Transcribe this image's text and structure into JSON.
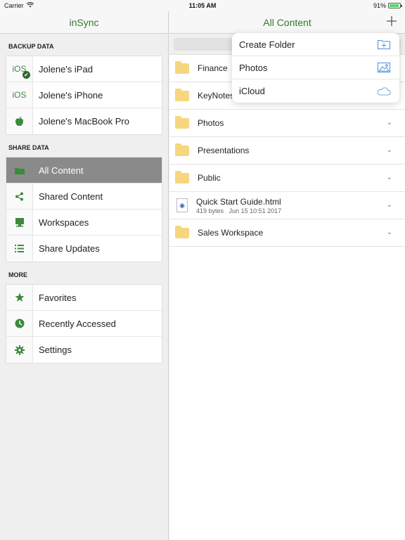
{
  "status": {
    "carrier": "Carrier",
    "time": "11:05 AM",
    "battery": "91%",
    "battery_level": 0.91
  },
  "sidebar": {
    "title": "inSync",
    "backup": {
      "header": "BACKUP DATA",
      "items": [
        {
          "label": "Jolene's iPad",
          "icon": "ios-icon",
          "icon_text": "iOS"
        },
        {
          "label": "Jolene's iPhone",
          "icon": "ios-icon",
          "icon_text": "iOS"
        },
        {
          "label": "Jolene's MacBook Pro",
          "icon": "apple-icon"
        }
      ]
    },
    "share": {
      "header": "SHARE DATA",
      "items": [
        {
          "label": "All Content",
          "icon": "folder-icon"
        },
        {
          "label": "Shared Content",
          "icon": "share-icon"
        },
        {
          "label": "Workspaces",
          "icon": "workspace-icon"
        },
        {
          "label": "Share Updates",
          "icon": "list-icon"
        }
      ]
    },
    "more": {
      "header": "MORE",
      "items": [
        {
          "label": "Favorites",
          "icon": "star-icon"
        },
        {
          "label": "Recently Accessed",
          "icon": "clock-icon"
        },
        {
          "label": "Settings",
          "icon": "gear-icon"
        }
      ]
    }
  },
  "main": {
    "title": "All Content",
    "files": [
      {
        "name": "Finance",
        "type": "folder"
      },
      {
        "name": "KeyNotes",
        "type": "folder"
      },
      {
        "name": "Photos",
        "type": "folder"
      },
      {
        "name": "Presentations",
        "type": "folder"
      },
      {
        "name": "Public",
        "type": "folder"
      },
      {
        "name": "Quick Start Guide.html",
        "type": "file",
        "size": "419 bytes",
        "date": "Jun 15 10:51 2017"
      },
      {
        "name": "Sales Workspace",
        "type": "folder"
      }
    ]
  },
  "popover": {
    "items": [
      {
        "label": "Create Folder",
        "icon": "folder-plus-icon"
      },
      {
        "label": "Photos",
        "icon": "image-icon"
      },
      {
        "label": "iCloud",
        "icon": "cloud-icon"
      }
    ]
  },
  "colors": {
    "accent": "#2f7a2f",
    "selected": "#8a8a8a",
    "folder": "#f6d780",
    "popover_icon": "#4a90d9"
  }
}
